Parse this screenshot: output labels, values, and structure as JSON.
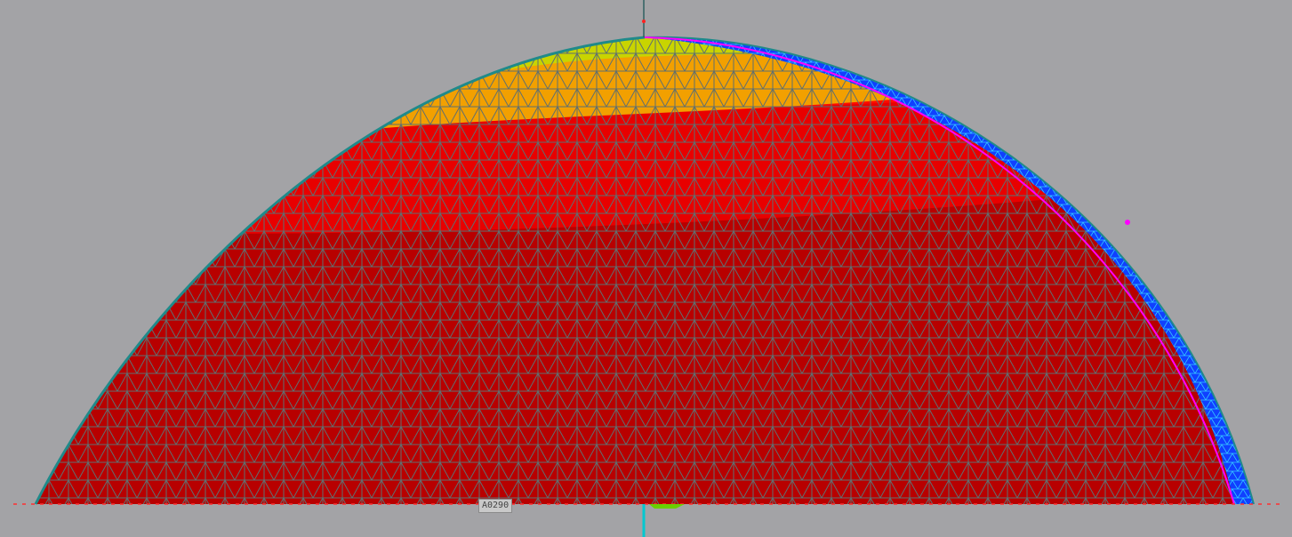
{
  "viewport": {
    "background": "#a3a3a6",
    "mesh_line_color": "#5f6f70",
    "band_colors": [
      "#b80000",
      "#e80000",
      "#ff0c00",
      "#f2a000",
      "#c9d400",
      "#1040ff"
    ],
    "highlight_color": "#ff00ff",
    "axis_color": "#00c8d0",
    "node_label": "A0290"
  }
}
